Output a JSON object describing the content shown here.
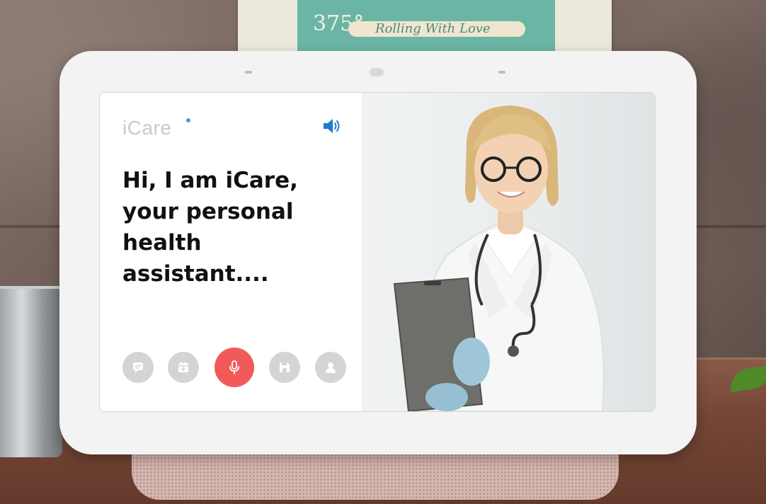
{
  "frame": {
    "number": "375°",
    "script": "Rolling With Love"
  },
  "app": {
    "brand": "iCare",
    "greeting": "Hi, I am iCare, your personal health assistant....",
    "icons": {
      "speaker": "speaker-icon",
      "chat": "chat-icon",
      "calendar": "calendar-add-icon",
      "mic": "microphone-icon",
      "save": "save-icon",
      "profile": "user-icon"
    }
  },
  "colors": {
    "accent_red": "#f25a5a",
    "accent_blue": "#1f7ad1",
    "button_gray": "#d4d4d4",
    "brand_gray": "#c9c9c9"
  }
}
